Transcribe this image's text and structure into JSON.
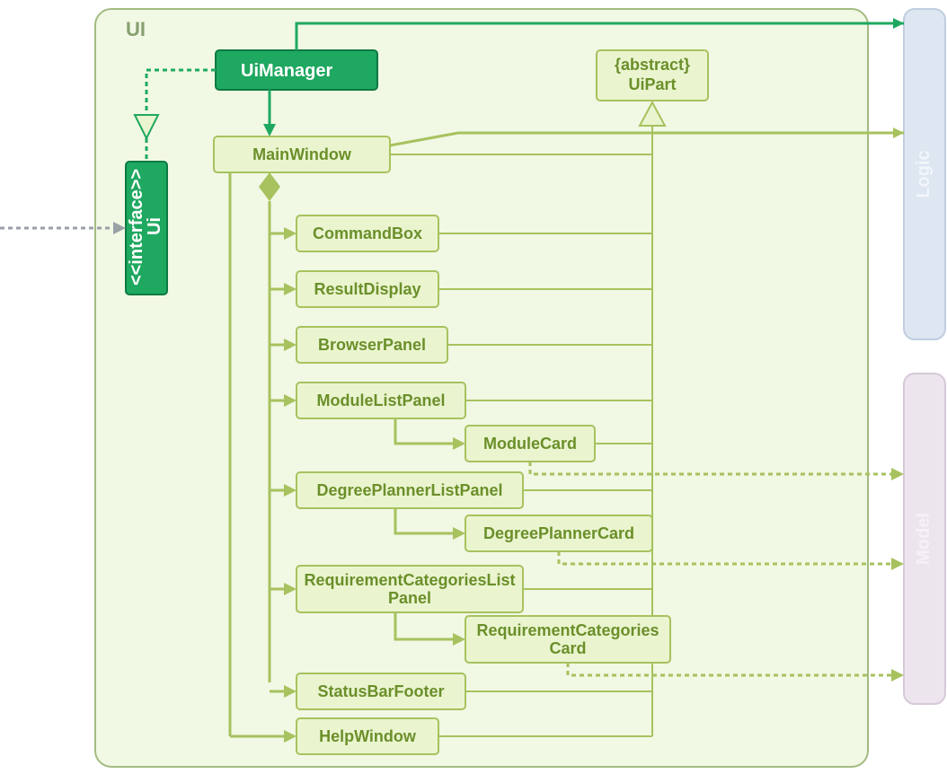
{
  "package": {
    "title": "UI"
  },
  "interface": {
    "stereotype": "<<interface>>",
    "name": "Ui"
  },
  "uiManager": "UiManager",
  "mainWindow": "MainWindow",
  "uiPart": {
    "stereotype": "{abstract}",
    "name": "UiPart"
  },
  "children": {
    "commandBox": "CommandBox",
    "resultDisplay": "ResultDisplay",
    "browserPanel": "BrowserPanel",
    "moduleListPanel": "ModuleListPanel",
    "moduleCard": "ModuleCard",
    "degreePlannerListPanel": "DegreePlannerListPanel",
    "degreePlannerCard": "DegreePlannerCard",
    "requirementCategoriesListPanel_l1": "RequirementCategoriesList",
    "requirementCategoriesListPanel_l2": "Panel",
    "requirementCategoriesCard_l1": "RequirementCategories",
    "requirementCategoriesCard_l2": "Card",
    "statusBarFooter": "StatusBarFooter",
    "helpWindow": "HelpWindow"
  },
  "sidePanels": {
    "logic": "Logic",
    "model": "Model"
  }
}
